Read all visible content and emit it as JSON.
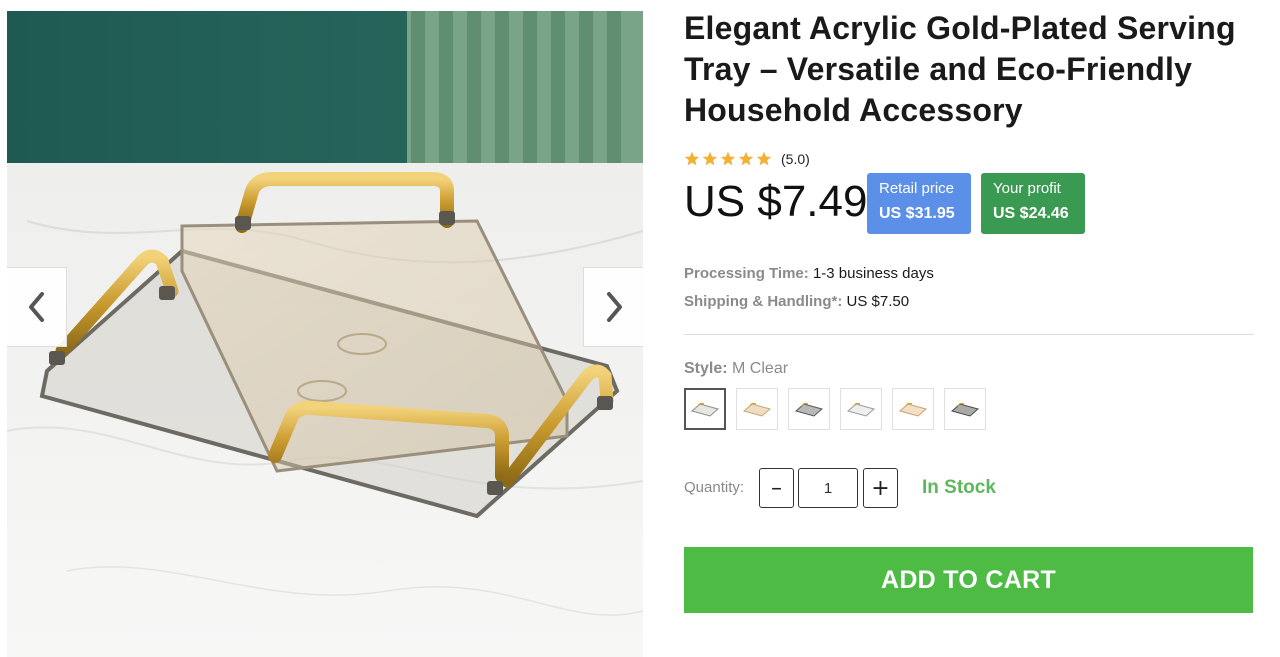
{
  "product": {
    "title": "Elegant Acrylic Gold-Plated Serving Tray – Versatile and Eco-Friendly Household Accessory",
    "rating": 5.0,
    "rating_text": "(5.0)",
    "price": "US $7.49",
    "retail": {
      "label": "Retail price",
      "value": "US $31.95",
      "color": "#5b8fe8"
    },
    "profit": {
      "label": "Your profit",
      "value": "US $24.46",
      "color": "#3a9a52"
    },
    "processing": {
      "label": "Processing Time:",
      "value": "1-3 business days"
    },
    "shipping": {
      "label": "Shipping & Handling*:",
      "value": "US $7.50"
    },
    "style": {
      "label": "Style:",
      "selected": "M Clear",
      "options": [
        "clear-tray",
        "gold-tray",
        "grey-tray",
        "clear-tray-small",
        "gold-tray-small",
        "grey-tray-small"
      ]
    },
    "quantity": {
      "label": "Quantity:",
      "value": "1",
      "minus": "–",
      "plus": "+"
    },
    "stock": "In Stock",
    "add_to_cart": "ADD TO CART"
  },
  "gallery": {
    "prev_icon": "chevron-left-icon",
    "next_icon": "chevron-right-icon"
  },
  "colors": {
    "star": "#f2b134",
    "stock": "#5cb85c",
    "cta": "#4ebb45"
  }
}
